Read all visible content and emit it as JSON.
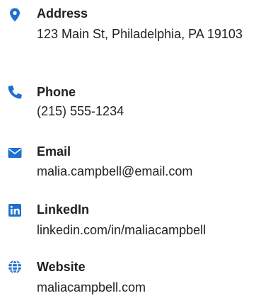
{
  "accent_color": "#1f6fcf",
  "contacts": {
    "address": {
      "icon": "location-pin-icon",
      "label": "Address",
      "value": "123 Main St, Philadelphia, PA 19103"
    },
    "phone": {
      "icon": "phone-icon",
      "label": "Phone",
      "value": "(215) 555-1234"
    },
    "email": {
      "icon": "envelope-icon",
      "label": "Email",
      "value": "malia.campbell@email.com"
    },
    "linkedin": {
      "icon": "linkedin-icon",
      "label": "LinkedIn",
      "value": "linkedin.com/in/maliacampbell"
    },
    "website": {
      "icon": "globe-icon",
      "label": "Website",
      "value": "maliacampbell.com"
    }
  }
}
